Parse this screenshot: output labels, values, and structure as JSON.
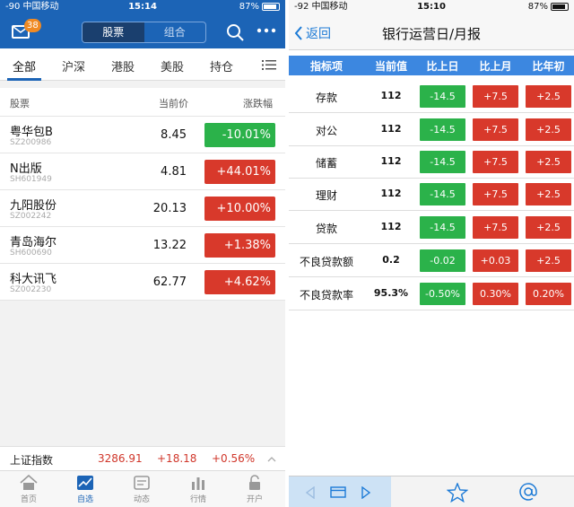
{
  "colors": {
    "brand_blue": "#1c64b6",
    "up_red": "#d8392b",
    "down_green": "#2bb24a",
    "table_header": "#3c87e0",
    "link_blue": "#1c7ad6",
    "badge_orange": "#f08a23"
  },
  "left": {
    "status": {
      "carrier": "-90 中国移动",
      "time": "15:14",
      "battery": "87%"
    },
    "header": {
      "badge_count": "38",
      "segments": [
        "股票",
        "组合"
      ],
      "active_segment": 0,
      "icons": [
        "mail-icon",
        "search-icon",
        "more-icon"
      ]
    },
    "tabs": [
      "全部",
      "沪深",
      "港股",
      "美股",
      "持仓"
    ],
    "columns": {
      "name": "股票",
      "price": "当前价",
      "change": "涨跌幅"
    },
    "stocks": [
      {
        "name": "粤华包B",
        "code": "SZ200986",
        "price": "8.45",
        "change": "-10.01%",
        "dir": "down"
      },
      {
        "name": "N出版",
        "code": "SH601949",
        "price": "4.81",
        "change": "+44.01%",
        "dir": "up"
      },
      {
        "name": "九阳股份",
        "code": "SZ002242",
        "price": "20.13",
        "change": "+10.00%",
        "dir": "up"
      },
      {
        "name": "青岛海尔",
        "code": "SH600690",
        "price": "13.22",
        "change": "+1.38%",
        "dir": "up"
      },
      {
        "name": "科大讯飞",
        "code": "SZ002230",
        "price": "62.77",
        "change": "+4.62%",
        "dir": "up"
      }
    ],
    "index_bar": {
      "name": "上证指数",
      "value": "3286.91",
      "change": "+18.18",
      "pct": "+0.56%"
    },
    "tabbar": [
      "首页",
      "自选",
      "动态",
      "行情",
      "开户"
    ],
    "tabbar_active": 1
  },
  "right": {
    "status": {
      "carrier": "-92 中国移动",
      "time": "15:10",
      "battery": "87%"
    },
    "back_label": "返回",
    "title": "银行运营日/月报",
    "columns": [
      "指标项",
      "当前值",
      "比上日",
      "比上月",
      "比年初"
    ],
    "rows": [
      {
        "label": "存款",
        "value": "112",
        "day": "-14.5",
        "month": "+7.5",
        "year": "+2.5"
      },
      {
        "label": "对公",
        "value": "112",
        "day": "-14.5",
        "month": "+7.5",
        "year": "+2.5"
      },
      {
        "label": "储蓄",
        "value": "112",
        "day": "-14.5",
        "month": "+7.5",
        "year": "+2.5"
      },
      {
        "label": "理财",
        "value": "112",
        "day": "-14.5",
        "month": "+7.5",
        "year": "+2.5"
      },
      {
        "label": "贷款",
        "value": "112",
        "day": "-14.5",
        "month": "+7.5",
        "year": "+2.5"
      },
      {
        "label": "不良贷款额",
        "value": "0.2",
        "day": "-0.02",
        "month": "+0.03",
        "year": "+2.5"
      },
      {
        "label": "不良贷款率",
        "value": "95.3%",
        "day": "-0.50%",
        "month": "0.30%",
        "year": "0.20%"
      }
    ],
    "toolbar_icons": [
      "prev-arrow-icon",
      "card-icon",
      "next-arrow-icon",
      "star-icon",
      "at-icon"
    ]
  }
}
